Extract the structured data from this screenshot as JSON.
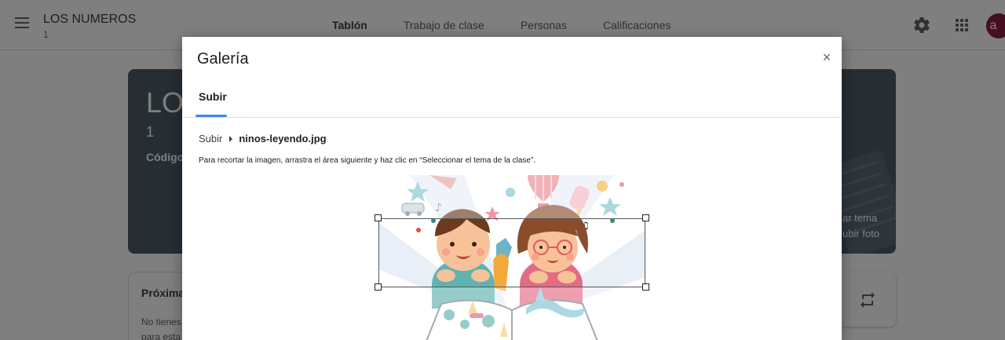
{
  "app": {
    "class_name": "LOS NUMEROS",
    "class_section": "1",
    "nav": [
      "Tablón",
      "Trabajo de clase",
      "Personas",
      "Calificaciones"
    ],
    "active_nav": "Tablón",
    "avatar_letter": "a",
    "avatar_color": "#8e1d47",
    "icons": [
      "menu-icon",
      "gear-icon",
      "apps-icon",
      "repeat-icon"
    ]
  },
  "banner": {
    "title": "LO",
    "section": "1",
    "code_label": "Código",
    "side_line1": "ar tema",
    "side_line2": "ubir foto",
    "color": "#4e5c67"
  },
  "upcoming": {
    "title": "Próxima",
    "text_line1": "No tienes",
    "text_line2": "para esta"
  },
  "dialog": {
    "title": "Galería",
    "close_symbol": "×",
    "tab": "Subir",
    "tab_indicator_color": "#4285f4",
    "breadcrumb_root": "Subir",
    "breadcrumb_file": "ninos-leyendo.jpg",
    "instructions": "Para recortar la imagen, arrastra el área siguiente y haz clic en “Seleccionar el tema de la clase”."
  }
}
